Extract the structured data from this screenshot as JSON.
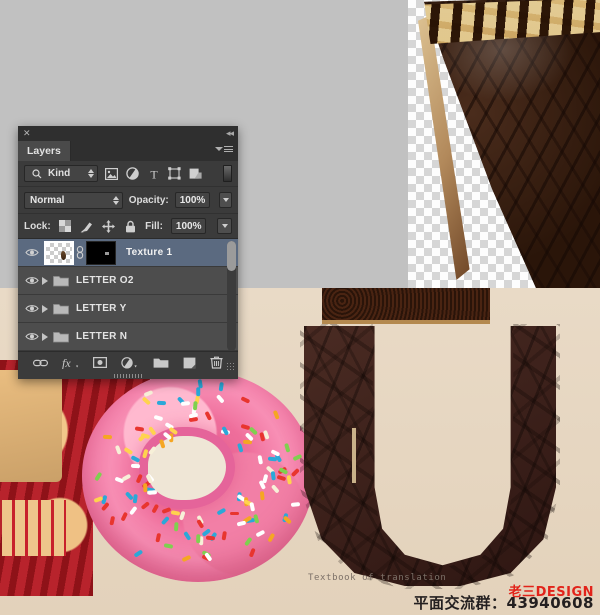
{
  "app": {
    "panel_title": "Layers",
    "close_label": "✕",
    "collapse_label": "◂◂"
  },
  "filter_bar": {
    "kind_label": "Kind",
    "search_icon": "search-icon",
    "icons": [
      {
        "name": "pixel-layer-filter-icon",
        "label": "Pixel layers"
      },
      {
        "name": "adjustment-layer-filter-icon",
        "label": "Adjustment layers"
      },
      {
        "name": "type-layer-filter-icon",
        "label": "T"
      },
      {
        "name": "shape-layer-filter-icon",
        "label": "Shape layers"
      },
      {
        "name": "smart-object-filter-icon",
        "label": "Smart objects"
      }
    ],
    "toggle_name": "filter-enable-toggle"
  },
  "blend_bar": {
    "blend_mode": "Normal",
    "opacity_label": "Opacity:",
    "opacity_value": "100%"
  },
  "lock_bar": {
    "lock_label": "Lock:",
    "lock_icons": [
      {
        "name": "lock-transparent-pixels-icon"
      },
      {
        "name": "lock-image-pixels-icon"
      },
      {
        "name": "lock-position-icon"
      },
      {
        "name": "lock-all-icon"
      }
    ],
    "fill_label": "Fill:",
    "fill_value": "100%"
  },
  "layers": [
    {
      "name": "Texture 1",
      "type": "layer",
      "selected": true,
      "visible": true,
      "linked": true,
      "has_mask": true
    },
    {
      "name": "LETTER O2",
      "type": "group",
      "selected": false,
      "visible": true
    },
    {
      "name": "LETTER Y",
      "type": "group",
      "selected": false,
      "visible": true
    },
    {
      "name": "LETTER N",
      "type": "group",
      "selected": false,
      "visible": true
    }
  ],
  "footer_icons": [
    {
      "name": "link-layers-icon"
    },
    {
      "name": "layer-style-fx-icon",
      "label": "fx"
    },
    {
      "name": "add-layer-mask-icon"
    },
    {
      "name": "new-adjustment-layer-icon"
    },
    {
      "name": "new-group-icon"
    },
    {
      "name": "new-layer-icon"
    },
    {
      "name": "delete-layer-icon"
    }
  ],
  "artwork": {
    "caption": "Textbook of translation",
    "letter_u": "U",
    "canvas_background": "#c1c1c1",
    "paper_background": "#e6d6c1"
  },
  "watermark": {
    "brand": "老三DESIGN",
    "qq": "平面交流群：43940608",
    "brand_color": "#e2231a"
  }
}
